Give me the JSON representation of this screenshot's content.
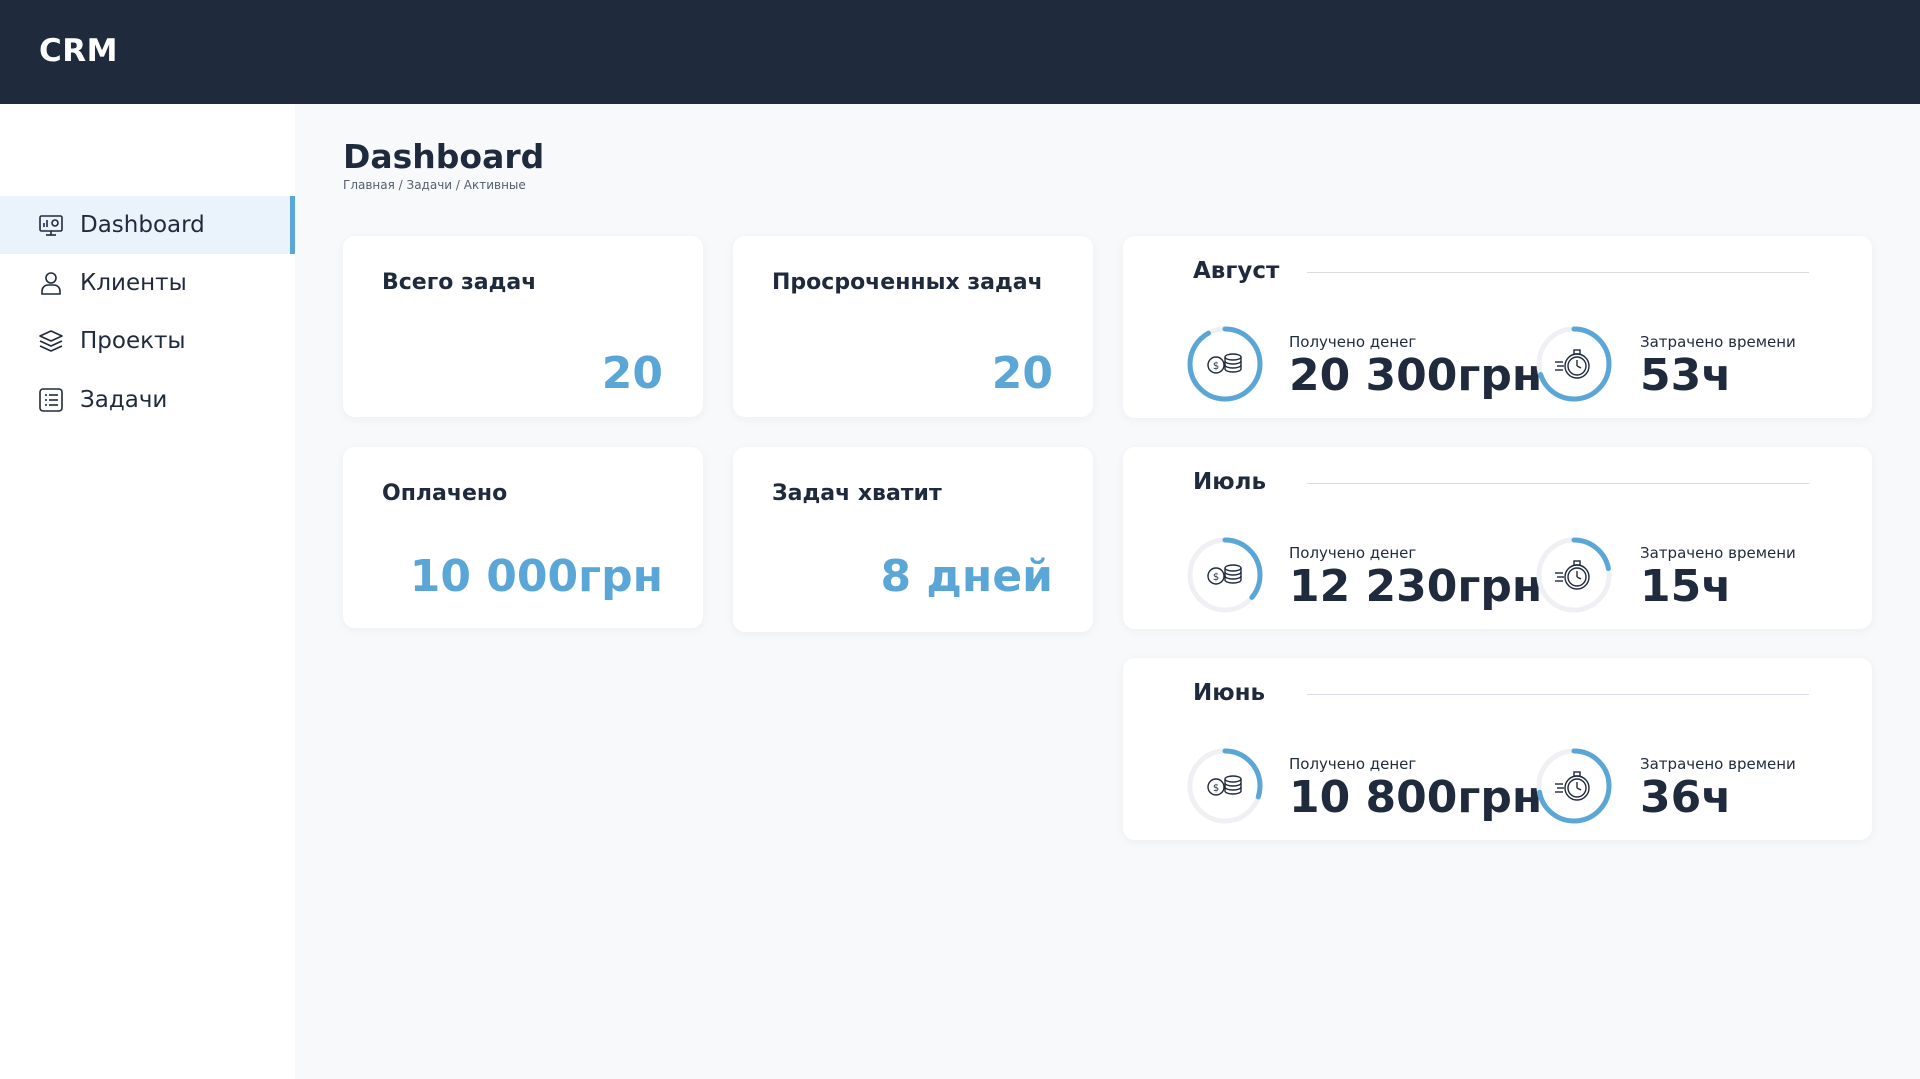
{
  "header": {
    "brand": "CRM"
  },
  "sidebar": {
    "items": [
      {
        "label": "Dashboard",
        "icon": "dashboard-icon",
        "active": true
      },
      {
        "label": "Клиенты",
        "icon": "user-icon",
        "active": false
      },
      {
        "label": "Проекты",
        "icon": "layers-icon",
        "active": false
      },
      {
        "label": "Задачи",
        "icon": "list-icon",
        "active": false
      }
    ]
  },
  "main": {
    "title": "Dashboard",
    "breadcrumb": "Главная / Задачи / Активные",
    "summary": [
      {
        "title": "Всего задач",
        "value": "20"
      },
      {
        "title": "Просроченных задач",
        "value": "20"
      },
      {
        "title": "Оплачено",
        "value": "10 000грн"
      },
      {
        "title": "Задач хватит",
        "value": "8 дней"
      }
    ],
    "months": [
      {
        "name": "Август",
        "money_label": "Получено денег",
        "money_value": "20 300грн",
        "money_progress": 0.92,
        "time_label": "Затрачено времени",
        "time_value": "53ч",
        "time_progress": 0.7
      },
      {
        "name": "Июль",
        "money_label": "Получено денег",
        "money_value": "12 230грн",
        "money_progress": 0.36,
        "time_label": "Затрачено времени",
        "time_value": "15ч",
        "time_progress": 0.22
      },
      {
        "name": "Июнь",
        "money_label": "Получено денег",
        "money_value": "10 800грн",
        "money_progress": 0.3,
        "time_label": "Затрачено времени",
        "time_value": "36ч",
        "time_progress": 0.72
      }
    ]
  },
  "colors": {
    "header": "#1f2a3d",
    "accent": "#5aa6d6",
    "ring_track": "#eef0f3",
    "active_item": "#eaf3fc"
  }
}
